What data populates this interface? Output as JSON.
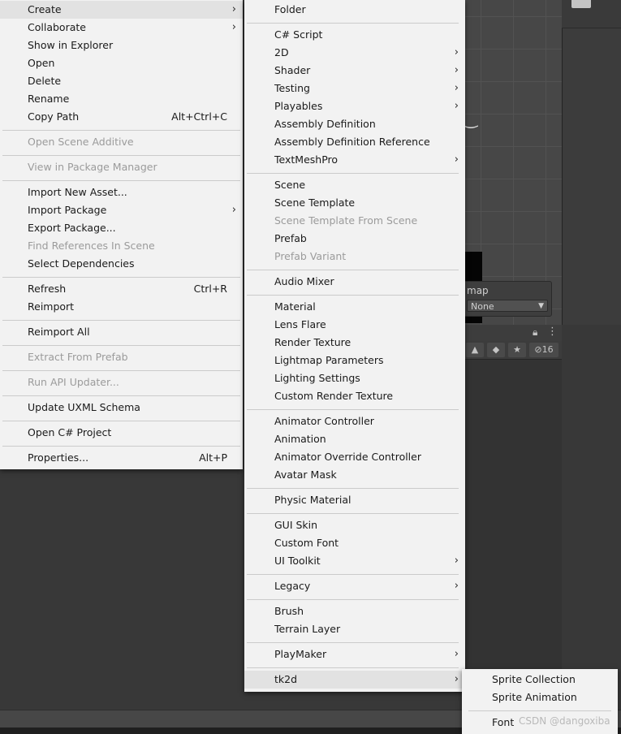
{
  "main_menu": {
    "items": [
      {
        "label": "Create",
        "submenu": true
      },
      {
        "label": "Collaborate",
        "submenu": true
      },
      {
        "label": "Show in Explorer"
      },
      {
        "label": "Open"
      },
      {
        "label": "Delete"
      },
      {
        "label": "Rename"
      },
      {
        "label": "Copy Path",
        "shortcut": "Alt+Ctrl+C"
      },
      {
        "label": "Open Scene Additive",
        "disabled": true
      },
      {
        "label": "View in Package Manager",
        "disabled": true
      },
      {
        "label": "Import New Asset..."
      },
      {
        "label": "Import Package",
        "submenu": true
      },
      {
        "label": "Export Package..."
      },
      {
        "label": "Find References In Scene",
        "disabled": true
      },
      {
        "label": "Select Dependencies"
      },
      {
        "label": "Refresh",
        "shortcut": "Ctrl+R"
      },
      {
        "label": "Reimport"
      },
      {
        "label": "Reimport All"
      },
      {
        "label": "Extract From Prefab",
        "disabled": true
      },
      {
        "label": "Run API Updater...",
        "disabled": true
      },
      {
        "label": "Update UXML Schema"
      },
      {
        "label": "Open C# Project"
      },
      {
        "label": "Properties...",
        "shortcut": "Alt+P"
      }
    ]
  },
  "create_menu": {
    "items": [
      {
        "label": "Folder"
      },
      {
        "label": "C# Script"
      },
      {
        "label": "2D",
        "submenu": true
      },
      {
        "label": "Shader",
        "submenu": true
      },
      {
        "label": "Testing",
        "submenu": true
      },
      {
        "label": "Playables",
        "submenu": true
      },
      {
        "label": "Assembly Definition"
      },
      {
        "label": "Assembly Definition Reference"
      },
      {
        "label": "TextMeshPro",
        "submenu": true
      },
      {
        "label": "Scene"
      },
      {
        "label": "Scene Template"
      },
      {
        "label": "Scene Template From Scene",
        "disabled": true
      },
      {
        "label": "Prefab"
      },
      {
        "label": "Prefab Variant",
        "disabled": true
      },
      {
        "label": "Audio Mixer"
      },
      {
        "label": "Material"
      },
      {
        "label": "Lens Flare"
      },
      {
        "label": "Render Texture"
      },
      {
        "label": "Lightmap Parameters"
      },
      {
        "label": "Lighting Settings"
      },
      {
        "label": "Custom Render Texture"
      },
      {
        "label": "Animator Controller"
      },
      {
        "label": "Animation"
      },
      {
        "label": "Animator Override Controller"
      },
      {
        "label": "Avatar Mask"
      },
      {
        "label": "Physic Material"
      },
      {
        "label": "GUI Skin"
      },
      {
        "label": "Custom Font"
      },
      {
        "label": "UI Toolkit",
        "submenu": true
      },
      {
        "label": "Legacy",
        "submenu": true
      },
      {
        "label": "Brush"
      },
      {
        "label": "Terrain Layer"
      },
      {
        "label": "PlayMaker",
        "submenu": true
      },
      {
        "label": "tk2d",
        "submenu": true
      }
    ]
  },
  "tk2d_menu": {
    "items": [
      {
        "label": "Sprite Collection"
      },
      {
        "label": "Sprite Animation"
      },
      {
        "label": "Font"
      }
    ]
  },
  "background": {
    "lightmap_label": "map",
    "lightmap_value": "None",
    "hidden_count": "16"
  },
  "watermark": "CSDN @dangoxiba"
}
